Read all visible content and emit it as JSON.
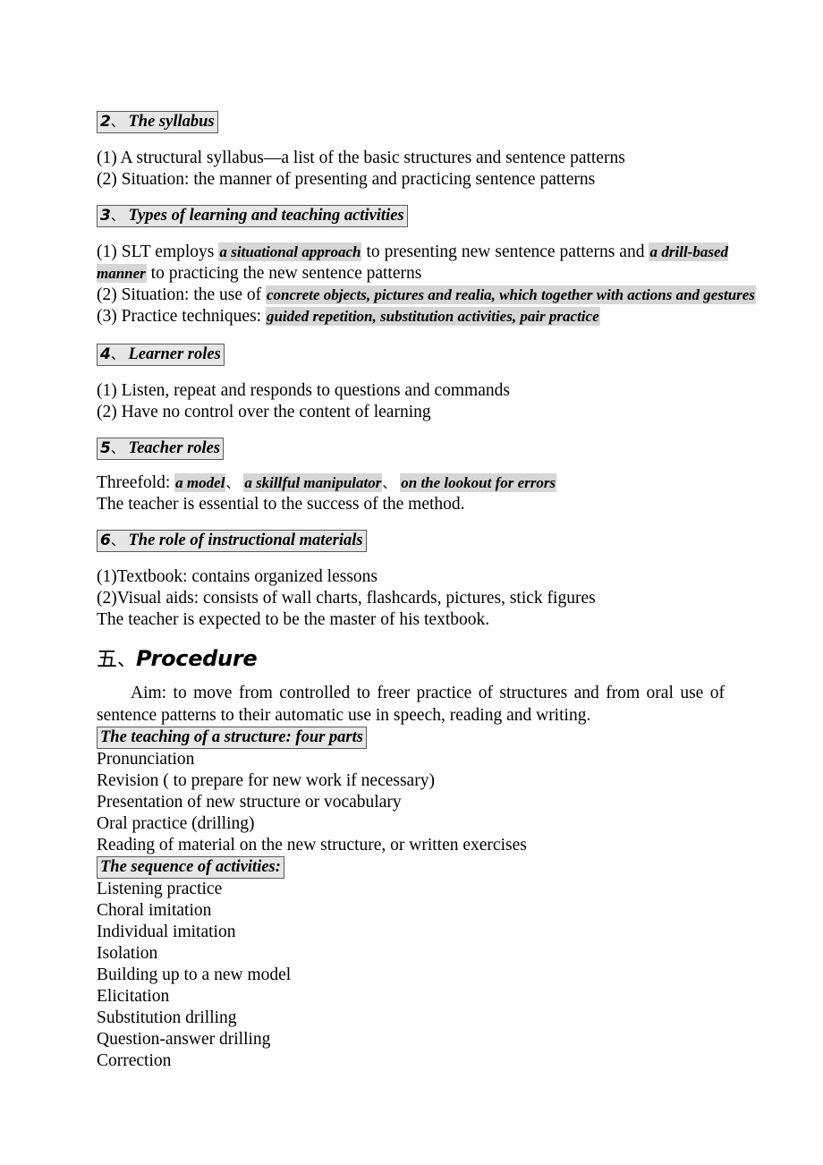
{
  "document": {
    "sections": [
      {
        "heading": {
          "num": "2",
          "sep": "、",
          "text": "The syllabus"
        },
        "items": [
          "(1) A structural syllabus—a list of the basic structures and sentence patterns",
          "(2) Situation: the manner of presenting and practicing sentence patterns"
        ]
      },
      {
        "heading": {
          "num": "3",
          "sep": "、",
          "text": "Types of learning and teaching activities"
        },
        "item1": {
          "prefix": "(1) SLT employs ",
          "hl1": "a situational approach",
          "mid": " to presenting new sentence patterns and ",
          "hl2": "a drill-based manner",
          "suffix": " to practicing the new sentence patterns"
        },
        "item2": {
          "prefix": "(2) Situation: the use of ",
          "hl1": "concrete objects, pictures and realia, which together with actions and gestures"
        },
        "item3": {
          "prefix": "(3) Practice techniques: ",
          "hl1": "guided repetition, substitution activities, pair practice"
        }
      },
      {
        "heading": {
          "num": "4",
          "sep": "、",
          "text": "Learner roles"
        },
        "items": [
          "(1) Listen, repeat and responds to questions and commands",
          "(2) Have no control over the content of learning"
        ]
      },
      {
        "heading": {
          "num": "5",
          "sep": "、",
          "text": "Teacher roles"
        },
        "threefold": {
          "prefix": "Threefold: ",
          "hl1": "a model",
          "sep1": "、",
          "hl2": "a skillful manipulator",
          "sep2": "、",
          "hl3": "on the lookout for errors"
        },
        "closing": "The teacher is essential to the success of the method."
      },
      {
        "heading": {
          "num": "6",
          "sep": "、",
          "text": "The role of instructional materials"
        },
        "items": [
          "(1)Textbook: contains organized lessons",
          "(2)Visual aids: consists of wall charts, flashcards, pictures, stick figures",
          "The teacher is expected to be the master of his textbook."
        ]
      }
    ],
    "procedure": {
      "title": {
        "num": "五",
        "sep": "、",
        "text": "Procedure"
      },
      "aim": "Aim: to move from controlled to freer practice of structures and from oral use of sentence patterns to their automatic use in speech, reading and writing.",
      "subheading_1": "The teaching of a structure: four parts",
      "parts": [
        "Pronunciation",
        "Revision ( to prepare for new work if necessary)",
        "Presentation of new structure or vocabulary",
        "Oral practice (drilling)",
        "Reading of material on the new structure, or written exercises"
      ],
      "subheading_2": "The sequence of activities:",
      "activities": [
        "Listening practice",
        "Choral imitation",
        "Individual imitation",
        "Isolation",
        "Building up to a new model",
        "Elicitation",
        "Substitution drilling",
        "Question-answer drilling",
        "Correction"
      ]
    }
  }
}
